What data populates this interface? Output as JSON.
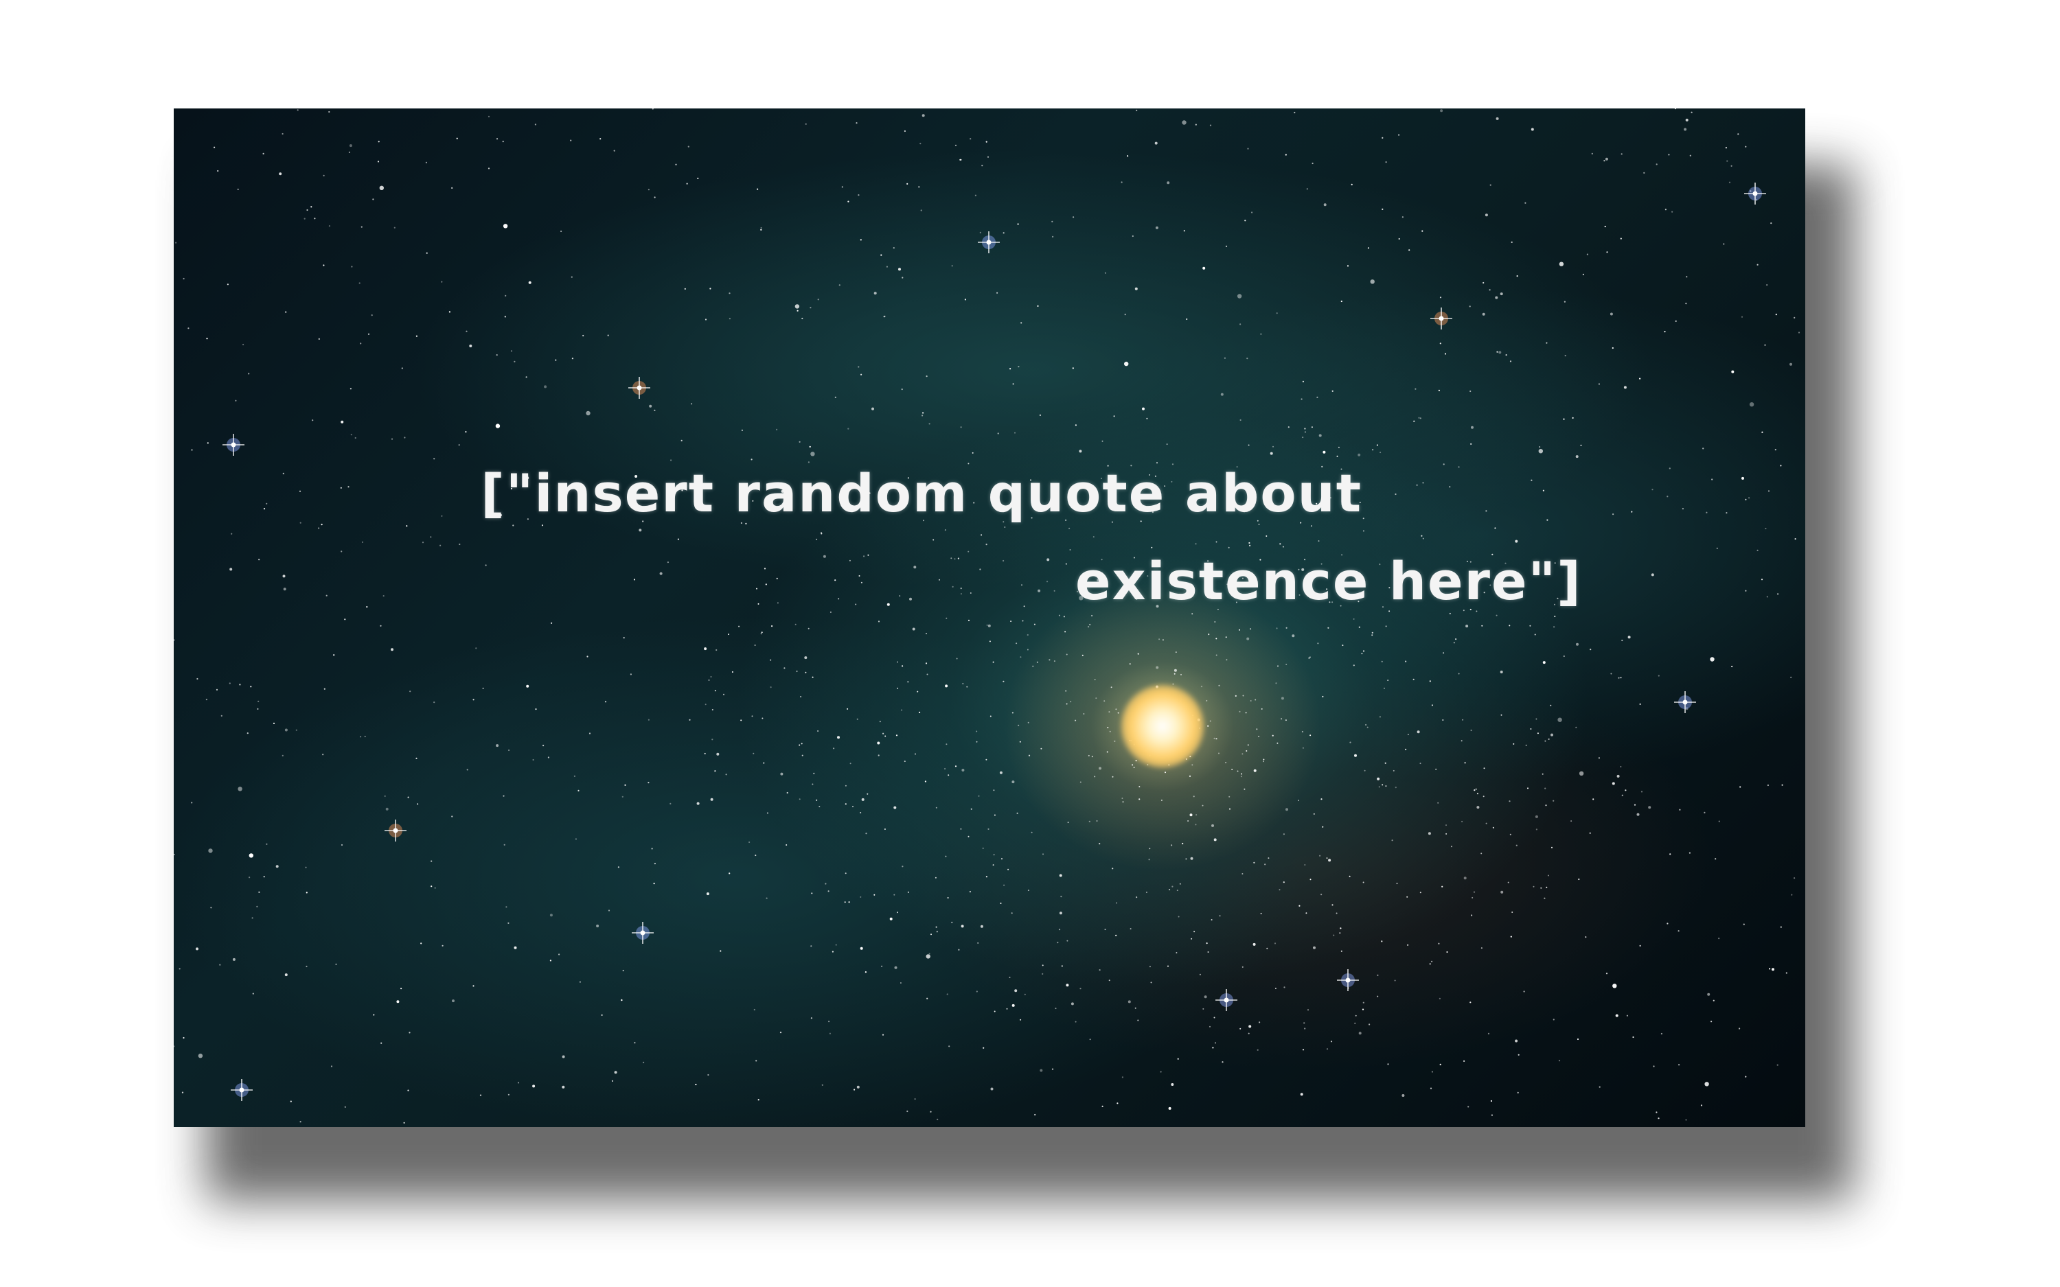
{
  "quote": {
    "line1": "[\"insert random quote about",
    "line2": "existence here\"]"
  },
  "background": {
    "scene": "galaxy-starfield",
    "core_color": "#ffd27a",
    "nebula_color": "#2f8a86"
  },
  "colors": {
    "text": "#f4f4f4",
    "page": "#ffffff"
  }
}
